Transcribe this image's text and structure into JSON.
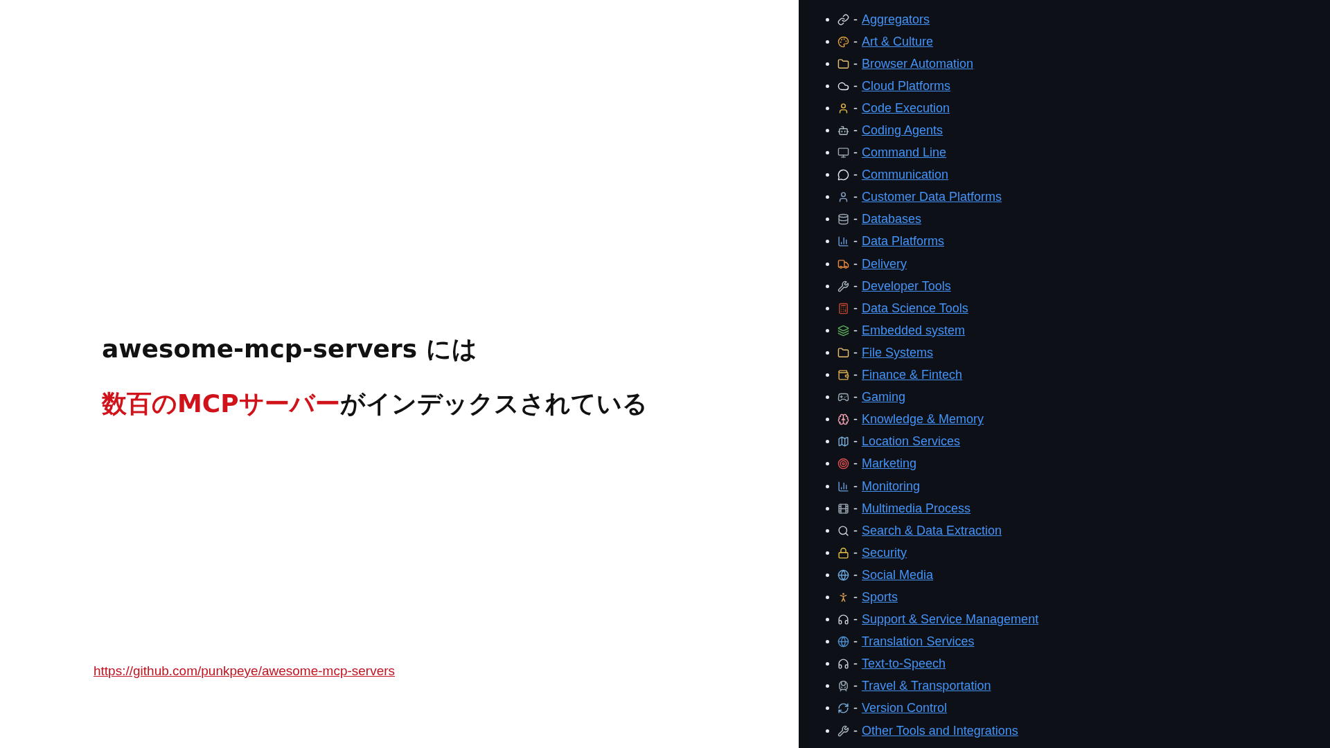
{
  "slide": {
    "title_line": "awesome-mcp-servers には",
    "highlight": "数百のMCPサーバー",
    "rest": "がインデックスされている",
    "source_link": "https://github.com/punkpeye/awesome-mcp-servers"
  },
  "categories": [
    {
      "separator": "-",
      "label": "Aggregators"
    },
    {
      "separator": "-",
      "label": "Art & Culture"
    },
    {
      "separator": "-",
      "label": "Browser Automation"
    },
    {
      "separator": "-",
      "label": "Cloud Platforms"
    },
    {
      "separator": "-",
      "label": "Code Execution"
    },
    {
      "separator": "-",
      "label": "Coding Agents"
    },
    {
      "separator": "-",
      "label": "Command Line"
    },
    {
      "separator": "-",
      "label": "Communication"
    },
    {
      "separator": "-",
      "label": "Customer Data Platforms"
    },
    {
      "separator": "-",
      "label": "Databases"
    },
    {
      "separator": "-",
      "label": "Data Platforms"
    },
    {
      "separator": "-",
      "label": "Delivery"
    },
    {
      "separator": "-",
      "label": "Developer Tools"
    },
    {
      "separator": "-",
      "label": "Data Science Tools"
    },
    {
      "separator": "-",
      "label": "Embedded system"
    },
    {
      "separator": "-",
      "label": "File Systems"
    },
    {
      "separator": "-",
      "label": "Finance & Fintech"
    },
    {
      "separator": "-",
      "label": "Gaming"
    },
    {
      "separator": "-",
      "label": "Knowledge & Memory"
    },
    {
      "separator": "-",
      "label": "Location Services"
    },
    {
      "separator": "-",
      "label": "Marketing"
    },
    {
      "separator": "-",
      "label": "Monitoring"
    },
    {
      "separator": "-",
      "label": "Multimedia Process"
    },
    {
      "separator": "-",
      "label": "Search & Data Extraction"
    },
    {
      "separator": "-",
      "label": "Security"
    },
    {
      "separator": "-",
      "label": "Social Media"
    },
    {
      "separator": "-",
      "label": "Sports"
    },
    {
      "separator": "-",
      "label": "Support & Service Management"
    },
    {
      "separator": "-",
      "label": "Translation Services"
    },
    {
      "separator": "-",
      "label": "Text-to-Speech"
    },
    {
      "separator": "-",
      "label": "Travel & Transportation"
    },
    {
      "separator": "-",
      "label": "Version Control"
    },
    {
      "separator": "-",
      "label": "Other Tools and Integrations"
    }
  ]
}
